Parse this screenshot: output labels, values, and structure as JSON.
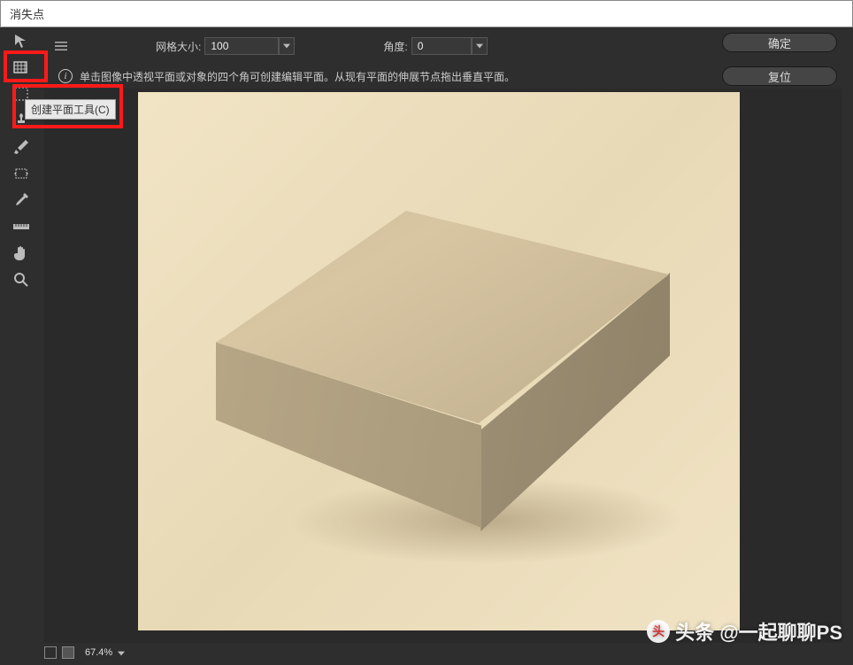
{
  "window": {
    "title": "消失点"
  },
  "options": {
    "grid_size_label": "网格大小:",
    "grid_size_value": "100",
    "angle_label": "角度:",
    "angle_value": "0"
  },
  "buttons": {
    "ok": "确定",
    "reset": "复位"
  },
  "info": {
    "hint": "单击图像中透视平面或对象的四个角可创建编辑平面。从现有平面的伸展节点拖出垂直平面。"
  },
  "tooltip": {
    "create_plane": "创建平面工具(C)"
  },
  "tools": {
    "edit_plane": "edit-plane-tool",
    "create_plane": "create-plane-tool",
    "marquee": "marquee-tool",
    "stamp": "stamp-tool",
    "brush": "brush-tool",
    "transform": "transform-tool",
    "eyedropper": "eyedropper-tool",
    "measure": "measure-tool",
    "hand": "hand-tool",
    "zoom": "zoom-tool"
  },
  "status": {
    "zoom": "67.4%"
  },
  "watermark": {
    "logo": "头",
    "text": "头条 @一起聊聊PS"
  }
}
